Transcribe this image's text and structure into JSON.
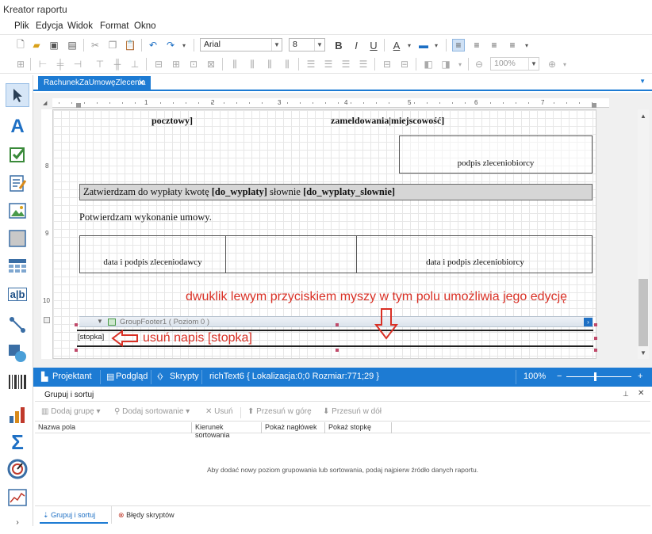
{
  "window": {
    "title": "Kreator raportu"
  },
  "menu": [
    "Plik",
    "Edycja",
    "Widok",
    "Format",
    "Okno"
  ],
  "toolbar": {
    "font": "Arial",
    "size": "8",
    "bold": "B",
    "italic": "I",
    "underline": "U",
    "zoom": "100%"
  },
  "tab": {
    "label": "RachunekZaUmowęZlecenia",
    "close": "✕"
  },
  "ruler": {
    "marks": [
      "1",
      "2",
      "3",
      "4",
      "5",
      "6",
      "7"
    ],
    "vmarks": [
      "8",
      "9",
      "10"
    ]
  },
  "report": {
    "pocztowy": "pocztowy]",
    "zameldowania": "zameldowania|miejscowość]",
    "podpis_top": "podpis zleceniobiorcy",
    "zatwierdzam_pre": "Zatwierdzam do wypłaty kwotę ",
    "zatwierdzam_b1": "[do_wyplaty]",
    "zatwierdzam_mid": " słownie ",
    "zatwierdzam_b2": "[do_wyplaty_slownie]",
    "potwierdzam": "Potwierdzam wykonanie umowy.",
    "podpis_left": "data i podpis zleceniodawcy",
    "podpis_right": "data i podpis zleceniobiorcy",
    "group_footer": "GroupFooter1 ( Poziom 0 )",
    "stopka": "[stopka]"
  },
  "annotations": {
    "top": "dwuklik lewym przyciskiem myszy w tym polu umożliwia jego edycję",
    "bottom": "usuń napis [stopka]"
  },
  "statusbar": {
    "projektant": "Projektant",
    "podglad": "Podgląd",
    "skrypty": "Skrypty",
    "info": "richText6 { Lokalizacja:0;0 Rozmiar:771;29 }",
    "zoom": "100%",
    "minus": "−",
    "plus": "+"
  },
  "group_panel": {
    "title": "Grupuj i sortuj",
    "buttons": [
      "Dodaj grupę",
      "Dodaj sortowanie",
      "Usuń",
      "Przesuń w górę",
      "Przesuń w dół"
    ],
    "columns": [
      "Nazwa pola",
      "Kierunek sortowania",
      "Pokaż nagłówek",
      "Pokaż stopkę"
    ],
    "empty": "Aby dodać nowy poziom grupowania lub sortowania, podaj najpierw źródło danych raportu.",
    "bottom_tabs": [
      "Grupuj i sortuj",
      "Błędy skryptów"
    ]
  }
}
